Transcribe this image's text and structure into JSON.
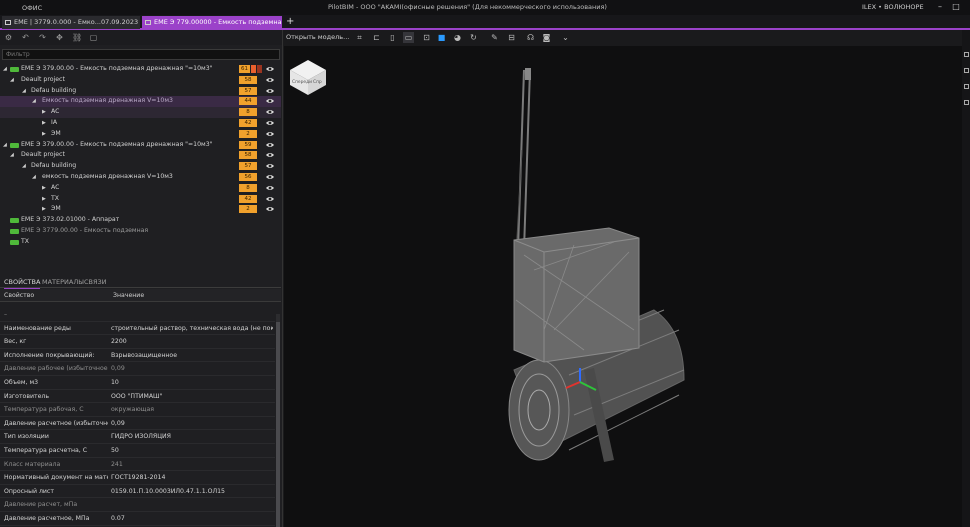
{
  "titlebar": {
    "menu_label": "OФИС",
    "app_title": "PilotBIM - ООО \"AKAMI(офисные решения\" (Для некоммерческого использования)",
    "user_label": "ILEX • ВОЛЮНОРЕ"
  },
  "tabs": [
    {
      "label": "EME | 3779.0.000 - Емко...07.09.2023 10:17"
    },
    {
      "label": "EME Э 779.00000 - Емкость подземная дре..."
    }
  ],
  "viewport_toolbar": {
    "open_model_label": "Открыть модель..."
  },
  "viewcube": {
    "left_label": "Спереди",
    "right_label": "Спр"
  },
  "filter": {
    "placeholder": "Фильтр"
  },
  "tree": [
    {
      "label": "EME Э 379.00.00 - Емкость подземная дренажная \"=10м3\"",
      "badge": "61"
    },
    {
      "label": "Deault project",
      "badge": "58"
    },
    {
      "label": "Defau building",
      "badge": "57"
    },
    {
      "label": "Емкость подземная дренажная V=10м3",
      "badge": "44"
    },
    {
      "label": "AC",
      "badge": "8"
    },
    {
      "label": "IA",
      "badge": "42"
    },
    {
      "label": "ЭМ",
      "badge": "2"
    },
    {
      "label": "EME Э 379.00.00 - Емкость подземная дренажная \"=10м3\"",
      "badge": "59"
    },
    {
      "label": "Deault project",
      "badge": "58"
    },
    {
      "label": "Defau building",
      "badge": "57"
    },
    {
      "label": "емкость подземная дренажная V=10м3",
      "badge": "56"
    },
    {
      "label": "AC",
      "badge": "8"
    },
    {
      "label": "TX",
      "badge": "42"
    },
    {
      "label": "ЭМ",
      "badge": "2"
    },
    {
      "label": "EME Э 373.02.01000 - Аппарат",
      "badge": ""
    },
    {
      "label": "EME Э 3779.00.00 - Емкость подземная",
      "badge": ""
    },
    {
      "label": "TX",
      "badge": ""
    }
  ],
  "prop_tabs": {
    "properties": "СВОЙСТВА",
    "materials": "МАТЕРИАЛЫ",
    "links": "СВЯЗИ"
  },
  "prop_header": {
    "key": "Свойство",
    "value": "Значение"
  },
  "props": [
    {
      "k": "–",
      "v": ""
    },
    {
      "k": "Наименование реды",
      "v": "строительный раствор, техническая вода (не покарося..."
    },
    {
      "k": "Вес, кг",
      "v": "2200"
    },
    {
      "k": "Исполнение покрывающий:",
      "v": "Взрывозащищенное"
    },
    {
      "k": "Давление рабочее (избыточное)",
      "v": "0,09"
    },
    {
      "k": "Объем, м3",
      "v": "10"
    },
    {
      "k": "Изготовитель",
      "v": "ООО \"ПТИМАШ\""
    },
    {
      "k": "Температура рабочая, С",
      "v": "окружающая"
    },
    {
      "k": "Давление расчетное (избыточное)",
      "v": "0,09"
    },
    {
      "k": "Тип изоляции",
      "v": "ГИДРО ИЗОЛЯЦИЯ"
    },
    {
      "k": "Температура расчетна, С",
      "v": "50"
    },
    {
      "k": "Класс материала",
      "v": "241"
    },
    {
      "k": "Нормативный документ на материал",
      "v": "ГОСТ19281-2014"
    },
    {
      "k": "Опросный лист",
      "v": "0159.01.П.10.0003ИЛ0.47.1.1.ОЛ15"
    },
    {
      "k": "Давление расчет, мПа",
      "v": ""
    },
    {
      "k": "Давление расчетное, МПа",
      "v": "0.07"
    },
    {
      "k": "Давление рабочее, МПа",
      "v": "0.07"
    }
  ],
  "colors": {
    "accent": "#9b42c9",
    "badge": "#f1a12c",
    "tree_icon": "#4fb83a"
  }
}
